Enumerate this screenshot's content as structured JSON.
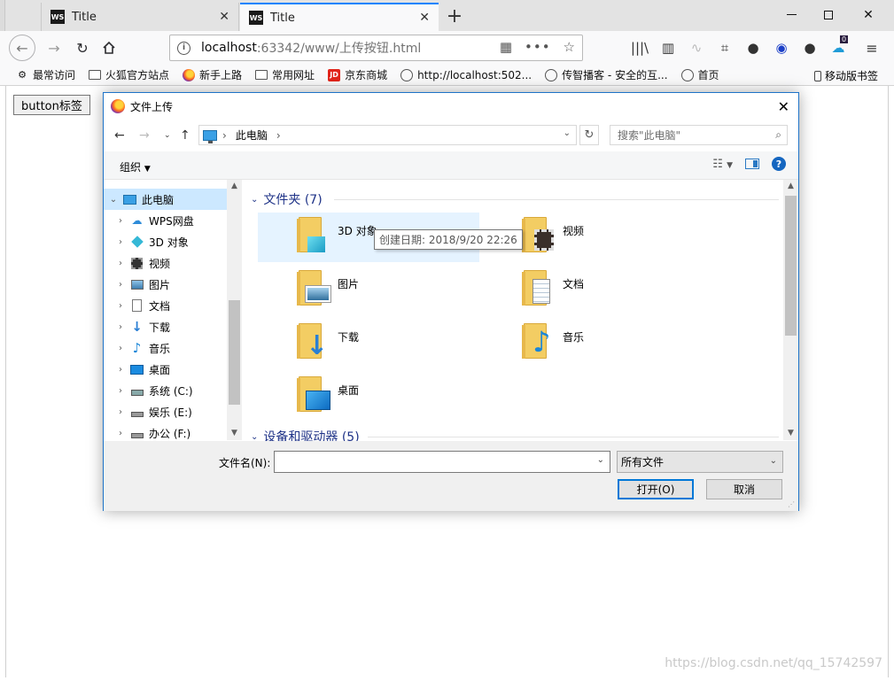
{
  "browser": {
    "tabs": [
      {
        "icon": "WS",
        "title": "Title"
      },
      {
        "icon": "WS",
        "title": "Title"
      }
    ],
    "url": {
      "host": "localhost",
      "rest": ":63342/www/上传按钮.html"
    },
    "bookmarks": [
      {
        "icon": "gear-icon",
        "label": "最常访问"
      },
      {
        "icon": "folder-icon",
        "label": "火狐官方站点"
      },
      {
        "icon": "firefox-icon",
        "label": "新手上路"
      },
      {
        "icon": "folder-icon",
        "label": "常用网址"
      },
      {
        "icon": "jd-icon",
        "label": "京东商城",
        "badge": "JD"
      },
      {
        "icon": "globe-icon",
        "label": "http://localhost:502..."
      },
      {
        "icon": "globe-icon",
        "label": "传智播客 - 安全的互..."
      },
      {
        "icon": "globe-icon",
        "label": "首页"
      }
    ],
    "mobile_bookmarks": "移动版书签",
    "notification_badge": "0"
  },
  "page": {
    "button_label": "button标签",
    "watermark": "https://blog.csdn.net/qq_15742597"
  },
  "dialog": {
    "title": "文件上传",
    "breadcrumb": "此电脑",
    "search_placeholder": "搜索\"此电脑\"",
    "organize_label": "组织",
    "nav_items": [
      {
        "label": "此电脑",
        "icon": "computer-icon",
        "selected": true,
        "expanded": true
      },
      {
        "label": "WPS网盘",
        "icon": "cloud-icon"
      },
      {
        "label": "3D 对象",
        "icon": "cube-icon"
      },
      {
        "label": "视频",
        "icon": "film-icon"
      },
      {
        "label": "图片",
        "icon": "picture-icon"
      },
      {
        "label": "文档",
        "icon": "document-icon"
      },
      {
        "label": "下载",
        "icon": "download-arrow-icon"
      },
      {
        "label": "音乐",
        "icon": "music-note-icon"
      },
      {
        "label": "桌面",
        "icon": "desktop-icon"
      },
      {
        "label": "系统 (C:)",
        "icon": "drive-icon"
      },
      {
        "label": "娱乐 (E:)",
        "icon": "drive-icon"
      },
      {
        "label": "办公 (F:)",
        "icon": "drive-icon"
      }
    ],
    "folders_group": "文件夹 (7)",
    "folders": [
      {
        "label": "3D 对象",
        "overlay": "cube"
      },
      {
        "label": "视频",
        "overlay": "film"
      },
      {
        "label": "图片",
        "overlay": "picture"
      },
      {
        "label": "文档",
        "overlay": "document"
      },
      {
        "label": "下载",
        "overlay": "download"
      },
      {
        "label": "音乐",
        "overlay": "music"
      },
      {
        "label": "桌面",
        "overlay": "desktop"
      }
    ],
    "devices_group": "设备和驱动器 (5)",
    "tooltip": "创建日期: 2018/9/20 22:26",
    "filename_label": "文件名(N):",
    "filename_value": "",
    "filetype_value": "所有文件",
    "open_label": "打开(O)",
    "cancel_label": "取消"
  },
  "colors": {
    "accent": "#0078d7",
    "group_header": "#1e3287",
    "selection": "#cce8ff",
    "hover": "#e5f3ff"
  }
}
